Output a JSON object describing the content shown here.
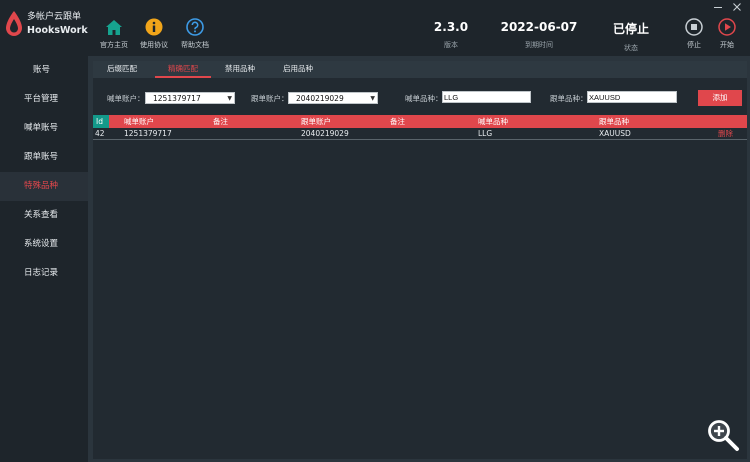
{
  "app": {
    "title": "多帐户云跟单",
    "subtitle": "HooksWork"
  },
  "sidebar": {
    "items": [
      {
        "label": "账号"
      },
      {
        "label": "平台管理"
      },
      {
        "label": "喊单账号"
      },
      {
        "label": "跟单账号"
      },
      {
        "label": "特殊品种"
      },
      {
        "label": "关系查看"
      },
      {
        "label": "系统设置"
      },
      {
        "label": "日志记录"
      }
    ],
    "active_index": 4
  },
  "toolbar": {
    "home_label": "官方主页",
    "agreement_label": "使用协议",
    "help_label": "帮助文档"
  },
  "info": {
    "version_value": "2.3.0",
    "version_label": "版本",
    "expiry_value": "2022-06-07",
    "expiry_label": "到期时间",
    "status_value": "已停止",
    "status_label": "状态"
  },
  "controls": {
    "stop_label": "停止",
    "start_label": "开始"
  },
  "tabs": [
    {
      "label": "后缀匹配"
    },
    {
      "label": "精确匹配"
    },
    {
      "label": "禁用品种"
    },
    {
      "label": "启用品种"
    }
  ],
  "active_tab": 1,
  "form": {
    "caller_account_label": "喊单账户：",
    "caller_account_value": "1251379717",
    "follower_account_label": "跟单账户：",
    "follower_account_value": "2040219029",
    "caller_symbol_label": "喊单品种：",
    "caller_symbol_value": "LLG",
    "follower_symbol_label": "跟单品种：",
    "follower_symbol_value": "XAUUSD",
    "add_label": "添加"
  },
  "table": {
    "headers": {
      "id": "Id",
      "caller_account": "喊单账户",
      "note1": "备注",
      "follower_account": "跟单账户",
      "note2": "备注",
      "caller_symbol": "喊单品种",
      "follower_symbol": "跟单品种"
    },
    "rows": [
      {
        "id": "42",
        "caller_account": "1251379717",
        "note1": "",
        "follower_account": "2040219029",
        "note2": "",
        "caller_symbol": "LLG",
        "follower_symbol": "XAUUSD",
        "action": "删除"
      }
    ]
  },
  "colors": {
    "accent": "#e0474c",
    "id_header": "#13998a",
    "home_icon": "#16a38f",
    "agreement_icon": "#f1a51a",
    "help_icon": "#3d9be6"
  },
  "icons": {
    "home": "home-icon",
    "agreement": "info-icon",
    "help": "question-icon",
    "stop": "stop-icon",
    "start": "play-icon",
    "zoom": "zoom-in-icon"
  }
}
